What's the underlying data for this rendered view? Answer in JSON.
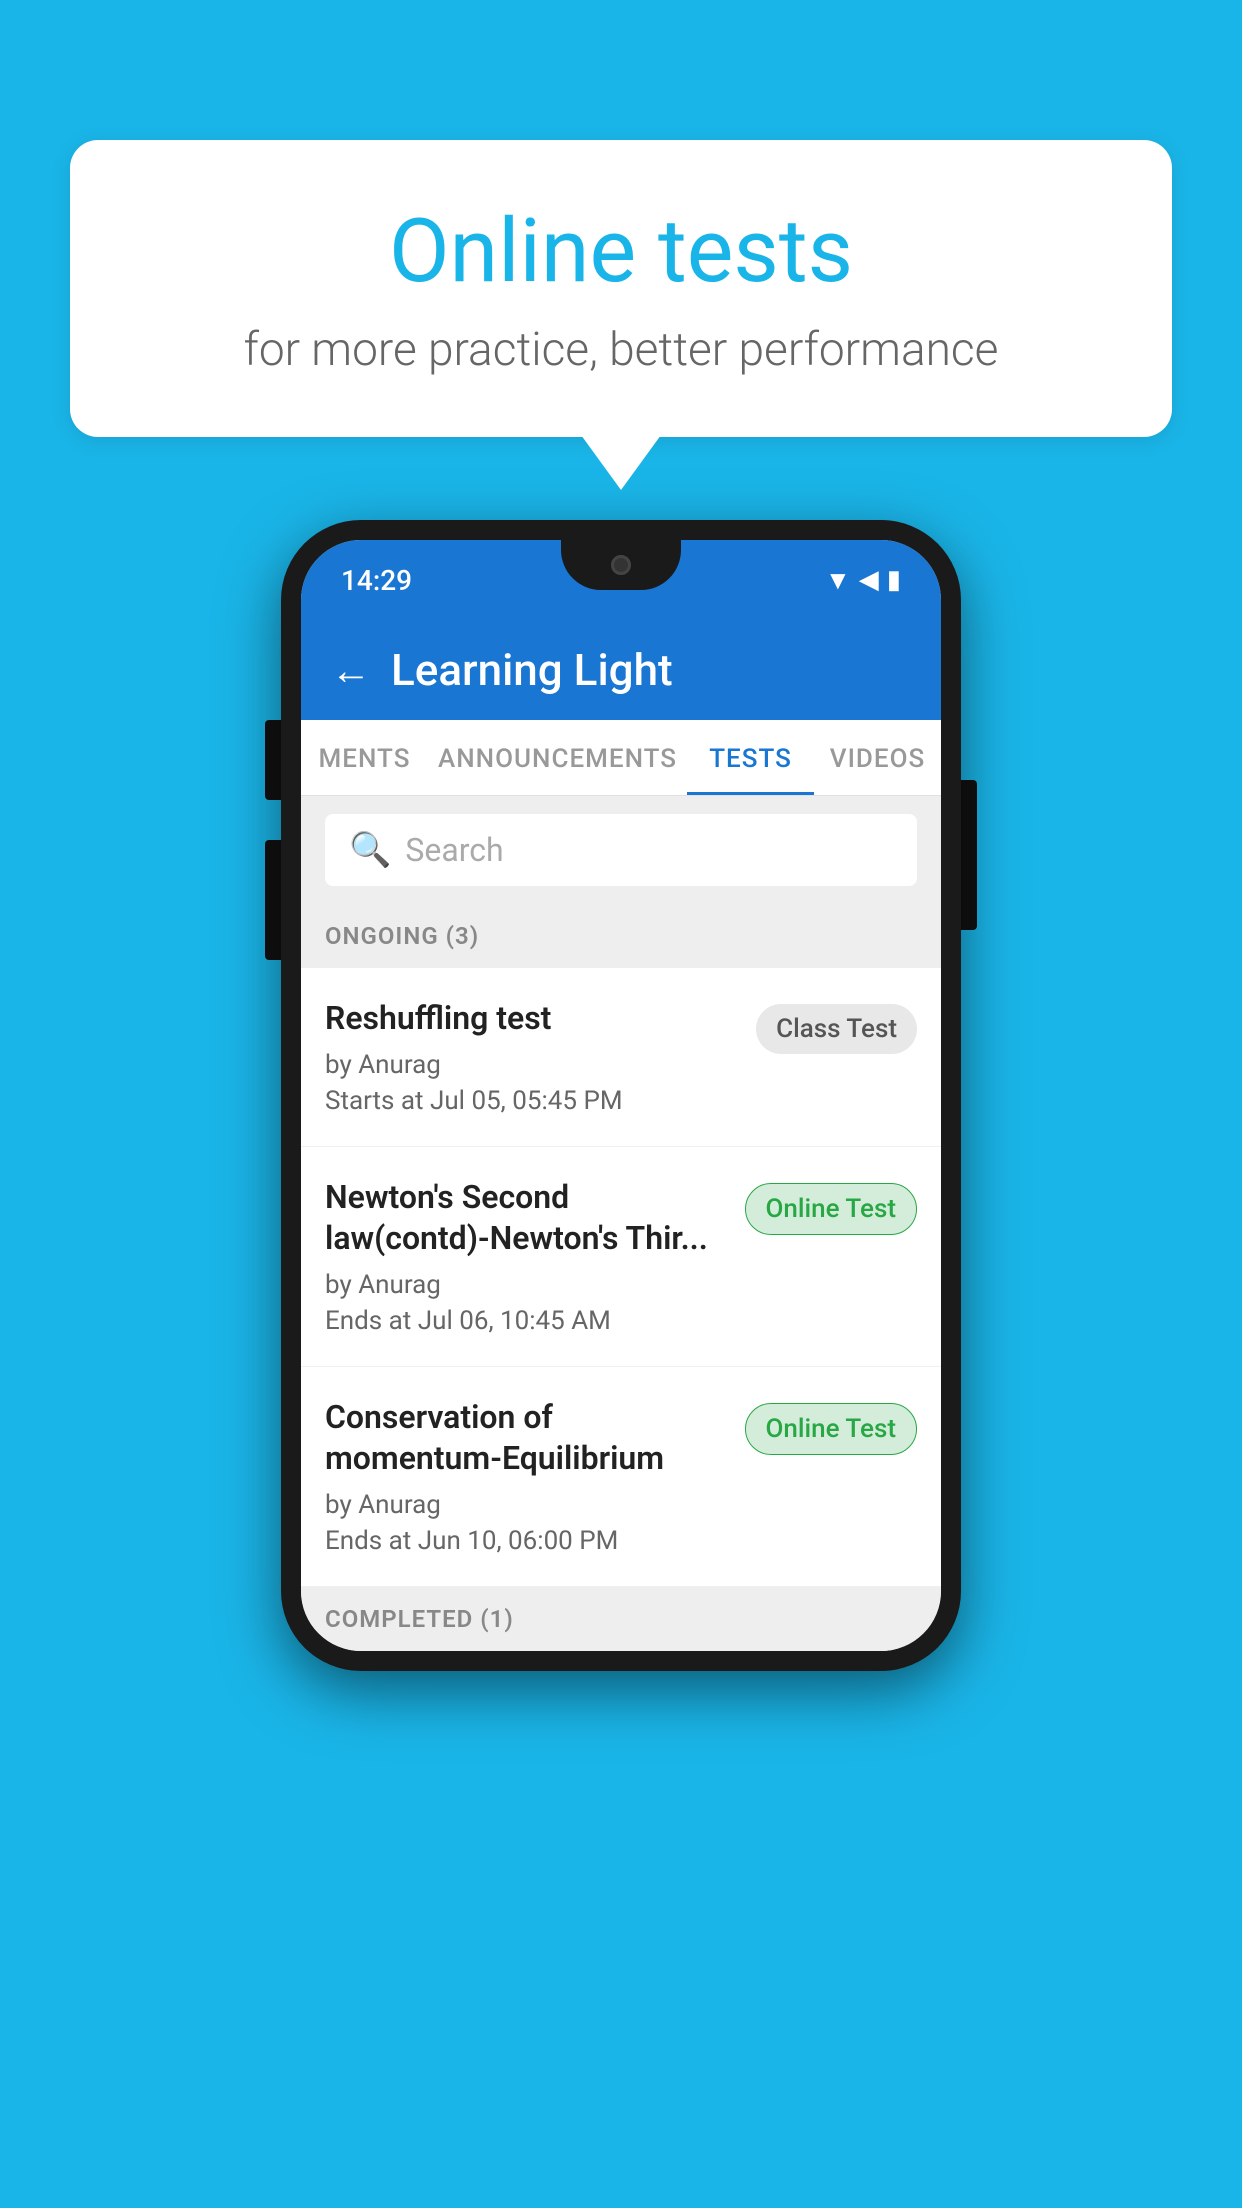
{
  "background": {
    "color": "#1ab5e8"
  },
  "speech_bubble": {
    "title": "Online tests",
    "subtitle": "for more practice, better performance"
  },
  "phone": {
    "status_bar": {
      "time": "14:29"
    },
    "app_header": {
      "title": "Learning Light",
      "back_label": "←"
    },
    "tabs": [
      {
        "label": "MENTS",
        "active": false
      },
      {
        "label": "ANNOUNCEMENTS",
        "active": false
      },
      {
        "label": "TESTS",
        "active": true
      },
      {
        "label": "VIDEOS",
        "active": false
      }
    ],
    "search": {
      "placeholder": "Search"
    },
    "ongoing_section": {
      "label": "ONGOING (3)"
    },
    "tests": [
      {
        "name": "Reshuffling test",
        "author": "by Anurag",
        "date": "Starts at  Jul 05, 05:45 PM",
        "badge": "Class Test",
        "badge_type": "class"
      },
      {
        "name": "Newton's Second law(contd)-Newton's Thir...",
        "author": "by Anurag",
        "date": "Ends at  Jul 06, 10:45 AM",
        "badge": "Online Test",
        "badge_type": "online"
      },
      {
        "name": "Conservation of momentum-Equilibrium",
        "author": "by Anurag",
        "date": "Ends at  Jun 10, 06:00 PM",
        "badge": "Online Test",
        "badge_type": "online"
      }
    ],
    "completed_section": {
      "label": "COMPLETED (1)"
    }
  }
}
